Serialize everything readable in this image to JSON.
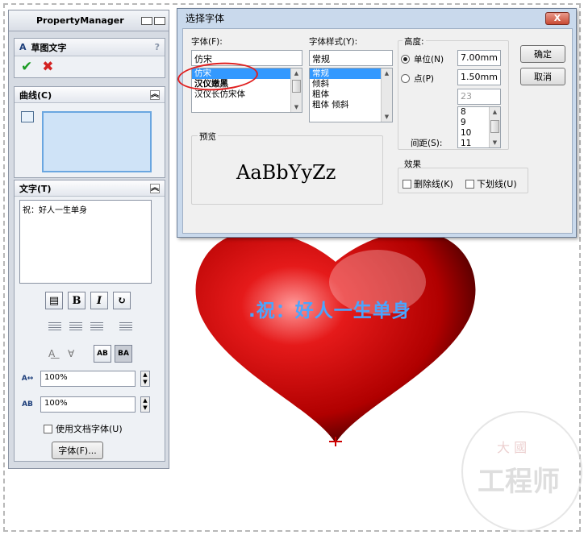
{
  "property_manager": {
    "title": "PropertyManager",
    "feature_title": "草图文字",
    "help": "?",
    "ok": "✔",
    "cancel": "✖",
    "curves_section": "曲线(C)",
    "text_section": "文字(T)",
    "text_value": "祝：好人一生单身",
    "bold_label": "B",
    "italic_label": "I",
    "width_factor": "100%",
    "spacing_factor": "100%",
    "use_doc_font_label": "使用文档字体(U)",
    "font_button_label": "字体(F)..."
  },
  "font_dialog": {
    "title": "选择字体",
    "close_label": "X",
    "font_label": "字体(F):",
    "font_value": "仿宋",
    "font_list": [
      "仿宋",
      "汉仪嫩黑",
      "汉仪长仿宋体"
    ],
    "style_label": "字体样式(Y):",
    "style_value": "常规",
    "style_list": [
      "常规",
      "倾斜",
      "粗体",
      "粗体 倾斜"
    ],
    "height_label": "高度:",
    "unit_label": "单位(N)",
    "unit_value": "7.00mm",
    "point_label": "点(P)",
    "point_value": "1.50mm",
    "point_size_field": "23",
    "point_size_list": [
      "8",
      "9",
      "10",
      "11"
    ],
    "spacing_label": "间距(S):",
    "preview_label": "预览",
    "preview_sample": "AaBbYyZz",
    "effects_label": "效果",
    "strikeout_label": "删除线(K)",
    "underline_label": "下划线(U)",
    "ok_button": "确定",
    "cancel_button": "取消"
  },
  "canvas": {
    "heart_text": ".祝：好人一生单身"
  },
  "watermark": {
    "text": "工程师",
    "small": "大 國"
  },
  "colors": {
    "heart_red": "#c40a0a",
    "text_blue": "#4aa5ff",
    "selection": "#3399ff"
  }
}
